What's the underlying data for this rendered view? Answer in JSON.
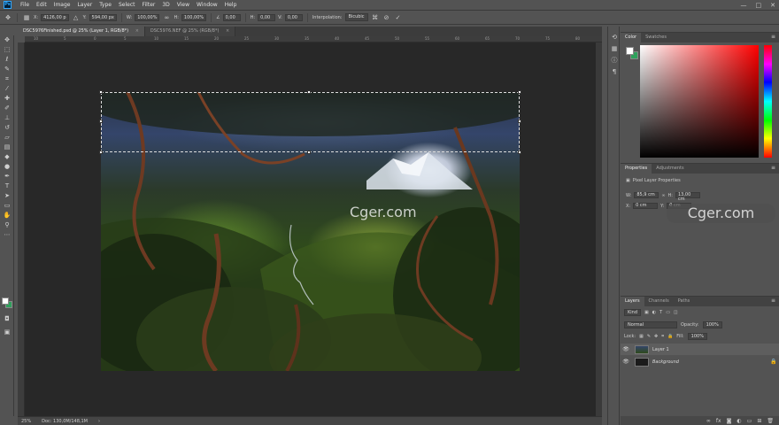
{
  "app": {
    "logo": "Ps",
    "colors": {
      "accent": "#31a8ff",
      "background_swatch": "#2fa05c"
    }
  },
  "menu": [
    "File",
    "Edit",
    "Image",
    "Layer",
    "Type",
    "Select",
    "Filter",
    "3D",
    "View",
    "Window",
    "Help"
  ],
  "window_controls": {
    "minimize": "—",
    "maximize": "□",
    "close": "✕"
  },
  "options_bar": {
    "x_label": "X:",
    "x_value": "4126,00 p",
    "y_label": "Y:",
    "y_value": "594,00 px",
    "w_label": "W:",
    "w_value": "100,00%",
    "h_label": "H:",
    "h_value": "100,00%",
    "angle_label": "∠",
    "angle_value": "0,00",
    "hskew_label": "H:",
    "hskew_value": "0,00",
    "vskew_label": "V:",
    "vskew_value": "0,00",
    "interp_label": "Interpolation:",
    "interp_value": "Bicubic"
  },
  "tabs": [
    {
      "label": "DSC5976Finished.psd @ 25% (Layer 1, RGB/8*)",
      "close": "×"
    },
    {
      "label": "DSC5976.NEF @ 25% (RGB/8*)",
      "close": "×"
    }
  ],
  "ruler_ticks": [
    "10",
    "5",
    "0",
    "5",
    "10",
    "15",
    "20",
    "25",
    "30",
    "35",
    "40",
    "45",
    "50",
    "55",
    "60",
    "65",
    "70",
    "75",
    "80"
  ],
  "status": {
    "zoom": "25%",
    "doc": "Doc: 130,0M/148,1M",
    "arrow": "›"
  },
  "color_panel": {
    "tabs": [
      "Color",
      "Swatches"
    ]
  },
  "properties_panel": {
    "tabs": [
      "Properties",
      "Adjustments"
    ],
    "title": "Pixel Layer Properties",
    "w_label": "W:",
    "w_value": "85,9 cm",
    "link": "∞",
    "h_label": "H:",
    "h_value": "13,00 cm",
    "x_label": "X:",
    "x_value": "0 cm",
    "y_label": "Y:",
    "y_value": "0 cm"
  },
  "layers_panel": {
    "tabs": [
      "Layers",
      "Channels",
      "Paths"
    ],
    "kind": "Kind",
    "blend_mode": "Normal",
    "opacity_label": "Opacity:",
    "opacity_value": "100%",
    "lock_label": "Lock:",
    "fill_label": "Fill:",
    "fill_value": "100%",
    "layers": [
      {
        "name": "Layer 1",
        "visible": "👁"
      },
      {
        "name": "Background",
        "visible": "👁",
        "lock": "🔒"
      }
    ]
  },
  "watermarks": {
    "center": "Cger.com",
    "right": "Cger.com"
  },
  "icons": [
    "move-tool-icon",
    "marquee-tool-icon",
    "lasso-tool-icon",
    "quick-select-icon",
    "crop-tool-icon",
    "eyedropper-icon",
    "healing-brush-icon",
    "brush-icon",
    "clone-stamp-icon",
    "history-brush-icon",
    "eraser-icon",
    "gradient-icon",
    "blur-icon",
    "dodge-icon",
    "pen-icon",
    "type-tool-icon",
    "path-select-icon",
    "rectangle-tool-icon",
    "hand-tool-icon",
    "zoom-tool-icon"
  ]
}
